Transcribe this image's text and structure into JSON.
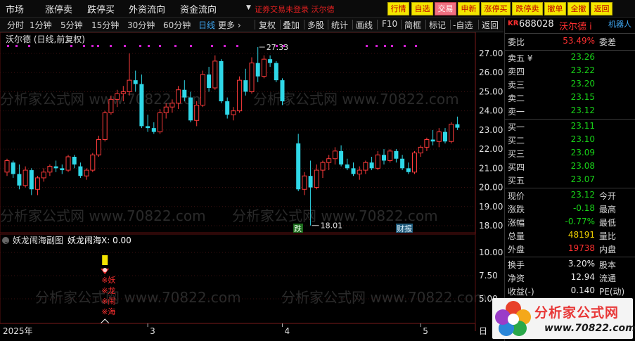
{
  "menu": {
    "items": [
      "市场",
      "涨停卖",
      "跌停买",
      "外资流向",
      "资金流向"
    ],
    "notice": "证券交易未登录 沃尔德"
  },
  "toolbar_buttons": [
    "行情",
    "自选",
    "交易",
    "申新",
    "涨停买",
    "跌停卖",
    "撤单",
    "全撤",
    "返回"
  ],
  "period_tabs": [
    "分时",
    "1分钟",
    "5分钟",
    "15分钟",
    "30分钟",
    "60分钟",
    "日线",
    "更多 ›"
  ],
  "period_active": "日线",
  "chart_tools": [
    "复权",
    "叠加",
    "多股",
    "统计",
    "画线",
    "F10",
    "简框",
    "标记",
    "-自选",
    "返回"
  ],
  "main_title": "沃尔德 (日线,前复权)",
  "sub_title": "妖龙闹海副图",
  "sub_value": "妖龙闹海X: 0.00",
  "watermark": "分析家公式网 www.70822.com",
  "logo": {
    "title": "分析家公式网",
    "url": "www.70822.com"
  },
  "colors": {
    "up": "#ff3b3b",
    "down": "#2fd8e8",
    "grid": "#3a1010",
    "marker": "#d020d0"
  },
  "chart_data": {
    "type": "candlestick",
    "ylim": [
      17.5,
      27.6
    ],
    "yticks": [
      "27.00",
      "26.00",
      "25.00",
      "24.00",
      "23.00",
      "22.00",
      "21.00",
      "20.00",
      "19.00",
      "18.00"
    ],
    "candles": [
      [
        20.8,
        21.5,
        20.6,
        21.4
      ],
      [
        21.3,
        21.4,
        20.5,
        20.7
      ],
      [
        20.7,
        21.2,
        19.9,
        20.1
      ],
      [
        20.1,
        21.1,
        20.0,
        20.9
      ],
      [
        20.9,
        21.0,
        19.6,
        19.9
      ],
      [
        19.9,
        20.6,
        19.6,
        20.5
      ],
      [
        20.5,
        21.0,
        20.3,
        20.8
      ],
      [
        20.8,
        21.2,
        20.6,
        21.1
      ],
      [
        21.1,
        21.4,
        20.8,
        21.0
      ],
      [
        21.0,
        21.2,
        20.7,
        20.9
      ],
      [
        20.9,
        21.7,
        20.8,
        21.6
      ],
      [
        21.6,
        21.7,
        21.0,
        21.2
      ],
      [
        21.1,
        21.3,
        20.5,
        20.6
      ],
      [
        20.6,
        21.0,
        20.4,
        20.9
      ],
      [
        20.9,
        21.8,
        20.8,
        21.7
      ],
      [
        21.7,
        22.7,
        21.6,
        22.5
      ],
      [
        22.5,
        24.0,
        22.4,
        23.9
      ],
      [
        23.9,
        24.8,
        23.8,
        24.6
      ],
      [
        24.6,
        25.1,
        24.2,
        24.9
      ],
      [
        24.9,
        25.3,
        24.5,
        25.0
      ],
      [
        25.0,
        27.0,
        24.8,
        25.6
      ],
      [
        25.6,
        26.1,
        25.0,
        25.4
      ],
      [
        25.4,
        25.9,
        23.1,
        23.2
      ],
      [
        23.2,
        23.8,
        22.9,
        23.1
      ],
      [
        23.1,
        23.4,
        22.8,
        22.9
      ],
      [
        22.9,
        24.1,
        22.8,
        23.9
      ],
      [
        23.9,
        24.4,
        23.6,
        24.2
      ],
      [
        24.2,
        24.6,
        23.9,
        24.4
      ],
      [
        24.4,
        25.3,
        24.1,
        25.1
      ],
      [
        25.1,
        25.6,
        24.5,
        24.7
      ],
      [
        24.7,
        25.0,
        23.4,
        23.5
      ],
      [
        23.5,
        24.5,
        23.2,
        24.3
      ],
      [
        24.3,
        26.1,
        24.2,
        25.9
      ],
      [
        25.9,
        26.3,
        25.0,
        25.2
      ],
      [
        25.2,
        26.9,
        25.1,
        26.6
      ],
      [
        26.6,
        26.7,
        24.4,
        24.5
      ],
      [
        24.5,
        24.7,
        23.6,
        23.8
      ],
      [
        23.8,
        24.2,
        23.5,
        24.0
      ],
      [
        24.0,
        25.8,
        23.9,
        25.6
      ],
      [
        25.6,
        26.2,
        24.8,
        25.0
      ],
      [
        25.0,
        26.8,
        24.9,
        26.5
      ],
      [
        26.5,
        27.33,
        25.5,
        25.8
      ],
      [
        25.8,
        26.9,
        25.7,
        26.7
      ],
      [
        26.7,
        26.9,
        26.3,
        26.5
      ],
      [
        26.5,
        26.6,
        25.5,
        25.6
      ],
      [
        25.6,
        25.7,
        24.3,
        24.5
      ],
      [
        22.3,
        22.8,
        19.8,
        19.9
      ],
      [
        19.9,
        20.8,
        19.6,
        20.6
      ],
      [
        20.6,
        21.4,
        18.01,
        20.0
      ],
      [
        20.0,
        21.2,
        19.9,
        20.9
      ],
      [
        20.9,
        21.4,
        20.5,
        21.3
      ],
      [
        21.3,
        21.7,
        20.9,
        21.5
      ],
      [
        21.5,
        22.1,
        21.2,
        21.9
      ],
      [
        21.9,
        22.2,
        21.1,
        21.2
      ],
      [
        21.2,
        21.5,
        20.9,
        21.0
      ],
      [
        21.0,
        21.3,
        20.6,
        20.7
      ],
      [
        20.7,
        21.1,
        20.4,
        20.9
      ],
      [
        20.9,
        21.4,
        20.7,
        21.3
      ],
      [
        21.3,
        21.6,
        20.9,
        21.0
      ],
      [
        21.0,
        21.9,
        20.9,
        21.7
      ],
      [
        21.7,
        22.0,
        21.2,
        21.4
      ],
      [
        21.4,
        22.0,
        21.3,
        21.9
      ],
      [
        21.9,
        22.0,
        21.3,
        21.5
      ],
      [
        21.5,
        21.7,
        20.9,
        21.0
      ],
      [
        21.0,
        21.3,
        20.7,
        20.8
      ],
      [
        20.8,
        21.9,
        20.7,
        21.8
      ],
      [
        21.8,
        22.2,
        21.6,
        22.1
      ],
      [
        22.1,
        22.6,
        21.9,
        22.5
      ],
      [
        22.5,
        23.0,
        22.2,
        22.4
      ],
      [
        22.4,
        23.1,
        22.1,
        22.9
      ],
      [
        22.9,
        23.1,
        22.3,
        22.4
      ],
      [
        22.4,
        23.4,
        22.3,
        23.3
      ],
      [
        23.3,
        23.7,
        23.0,
        23.12
      ]
    ],
    "annotations": {
      "high": "27.33",
      "low": "18.01",
      "mark_down": "跌",
      "mark_report": "财报"
    },
    "sub_ylim": [
      2.5,
      11.0
    ],
    "sub_yticks": [
      "10.00",
      "7.50",
      "5.00"
    ],
    "sub_signal_index": 16,
    "sub_signal_text": [
      "※妖",
      "※龙",
      "※闹",
      "※海"
    ],
    "x_labels": [
      "2025年",
      "3",
      "4",
      "5",
      "日"
    ]
  },
  "quote": {
    "market": "KR",
    "code": "688028",
    "name": "沃尔德 i",
    "tab": "机器人",
    "weibi_label": "委比",
    "weibi_val": "53.49%",
    "weicha_label": "委差",
    "sells": [
      {
        "label": "卖五 ¥",
        "price": "23.26"
      },
      {
        "label": "卖四",
        "price": "23.22"
      },
      {
        "label": "卖三",
        "price": "23.20"
      },
      {
        "label": "卖二",
        "price": "23.15"
      },
      {
        "label": "卖一",
        "price": "23.12"
      }
    ],
    "buys": [
      {
        "label": "买一",
        "price": "23.11"
      },
      {
        "label": "买二",
        "price": "23.10"
      },
      {
        "label": "买三",
        "price": "23.09"
      },
      {
        "label": "买四",
        "price": "23.08"
      },
      {
        "label": "买五",
        "price": "23.07"
      }
    ],
    "stats": [
      {
        "label": "现价",
        "val": "23.12",
        "extra": "今开"
      },
      {
        "label": "涨跌",
        "val": "-0.18",
        "extra": "最高"
      },
      {
        "label": "涨幅",
        "val": "-0.77%",
        "extra": "最低"
      },
      {
        "label": "总量",
        "val": "48191",
        "extra": "量比"
      },
      {
        "label": "外盘",
        "val": "19738",
        "extra": "内盘"
      }
    ],
    "stats2": [
      {
        "label": "换手",
        "val": "3.20%",
        "extra": "股本"
      },
      {
        "label": "净资",
        "val": "12.94",
        "extra": "流通"
      },
      {
        "label": "收益(-)",
        "val": "0.140",
        "extra": "PE(动)"
      }
    ]
  }
}
